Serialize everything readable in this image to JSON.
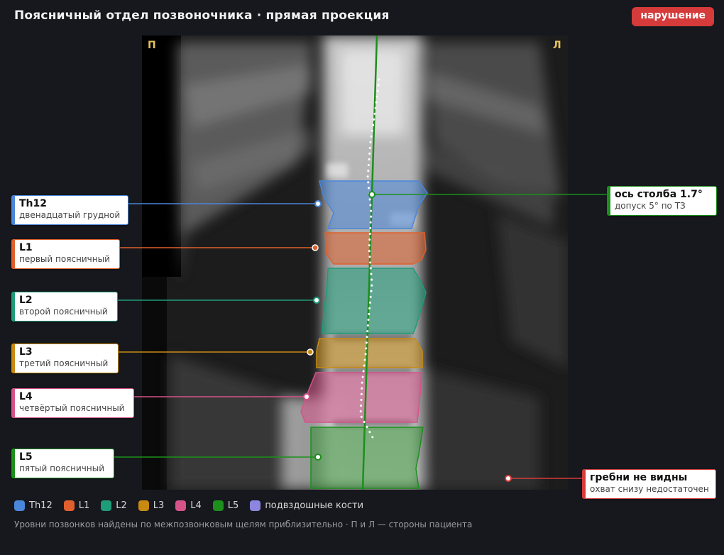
{
  "title": "Поясничный отдел позвоночника · прямая проекция",
  "status_badge": "нарушение",
  "sides": {
    "right": "П",
    "left": "Л"
  },
  "vertebrae": [
    {
      "name": "Th12",
      "desc": "двенадцатый грудной",
      "color": "#4a86d9"
    },
    {
      "name": "L1",
      "desc": "первый поясничный",
      "color": "#e0602d"
    },
    {
      "name": "L2",
      "desc": "второй поясничный",
      "color": "#1f9c7a"
    },
    {
      "name": "L3",
      "desc": "третий поясничный",
      "color": "#c98a12"
    },
    {
      "name": "L4",
      "desc": "четвёртый поясничный",
      "color": "#d6538a"
    },
    {
      "name": "L5",
      "desc": "пятый поясничный",
      "color": "#1c8f1c"
    }
  ],
  "axis_callout": {
    "title": "ось столба 1.7°",
    "desc": "допуск 5° по ТЗ",
    "color": "#1c8f1c"
  },
  "crest_callout": {
    "title": "гребни не видны",
    "desc": "охват снизу недостаточен",
    "color": "#d63b3b"
  },
  "legend": [
    {
      "label": "Th12",
      "color": "#4a86d9"
    },
    {
      "label": "L1",
      "color": "#e0602d"
    },
    {
      "label": "L2",
      "color": "#1f9c7a"
    },
    {
      "label": "L3",
      "color": "#c98a12"
    },
    {
      "label": "L4",
      "color": "#d6538a"
    },
    {
      "label": "L5",
      "color": "#1c8f1c"
    },
    {
      "label": "подвздошные кости",
      "color": "#8c86e0"
    }
  ],
  "footnote": "Уровни позвонков найдены по межпозвонковым щелям приблизительно · П и Л — стороны пациента"
}
